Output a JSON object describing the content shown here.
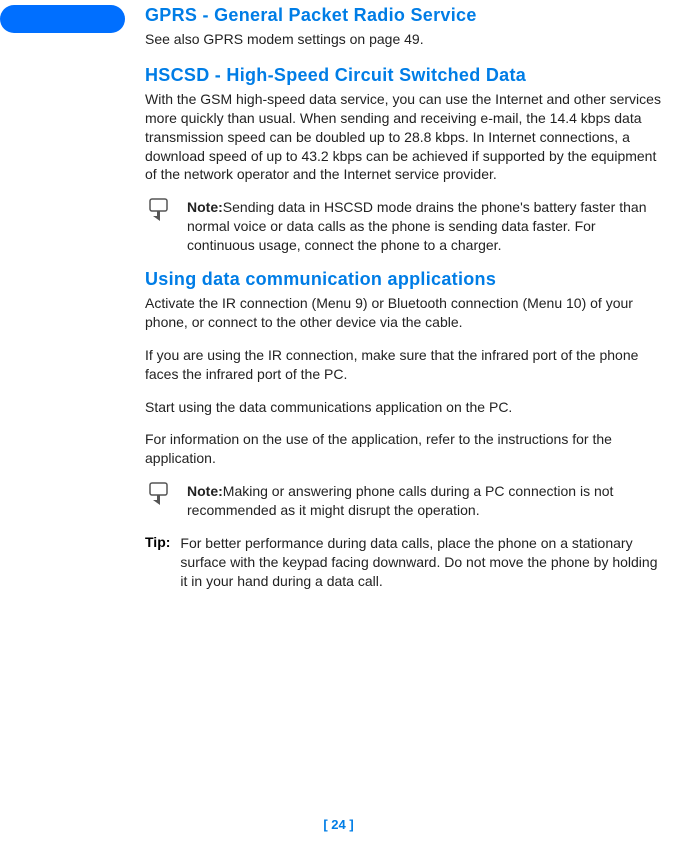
{
  "heading1": "GPRS - General Packet Radio Service",
  "subtext1": "See also GPRS modem settings on page 49.",
  "heading2": "HSCSD - High-Speed Circuit Switched Data",
  "paragraph1": "With the GSM high-speed data service, you can use the Internet and other services more quickly than usual. When sending and receiving e-mail, the 14.4 kbps data transmission speed can be doubled up to 28.8 kbps. In Internet connections, a download speed of up to 43.2 kbps can be achieved if supported by the equipment of the network operator and the Internet service provider.",
  "note1_label": "Note:",
  "note1_text": "Sending data in HSCSD mode drains the phone's battery faster than normal voice or data calls as the phone is sending data faster. For continuous usage, connect the phone to a charger.",
  "heading3": "Using data communication applications",
  "paragraph2": "Activate the IR connection (Menu 9) or Bluetooth connection (Menu 10) of your phone, or connect to the other device via the cable.",
  "paragraph3": "If you are using the IR connection, make sure that the infrared port of the phone faces the infrared port of the PC.",
  "paragraph4": "Start using the data communications application on the PC.",
  "paragraph5": "For information on the use of the application, refer to the instructions for the application.",
  "note2_label": "Note:",
  "note2_text": "Making or answering phone calls during a PC connection is not recommended as it might disrupt the operation.",
  "tip_label": "Tip:",
  "tip_text": "For better performance during data calls, place the phone on a stationary surface with the keypad facing downward. Do not move the phone by holding it in your hand during a data call.",
  "page_number": "[ 24 ]"
}
